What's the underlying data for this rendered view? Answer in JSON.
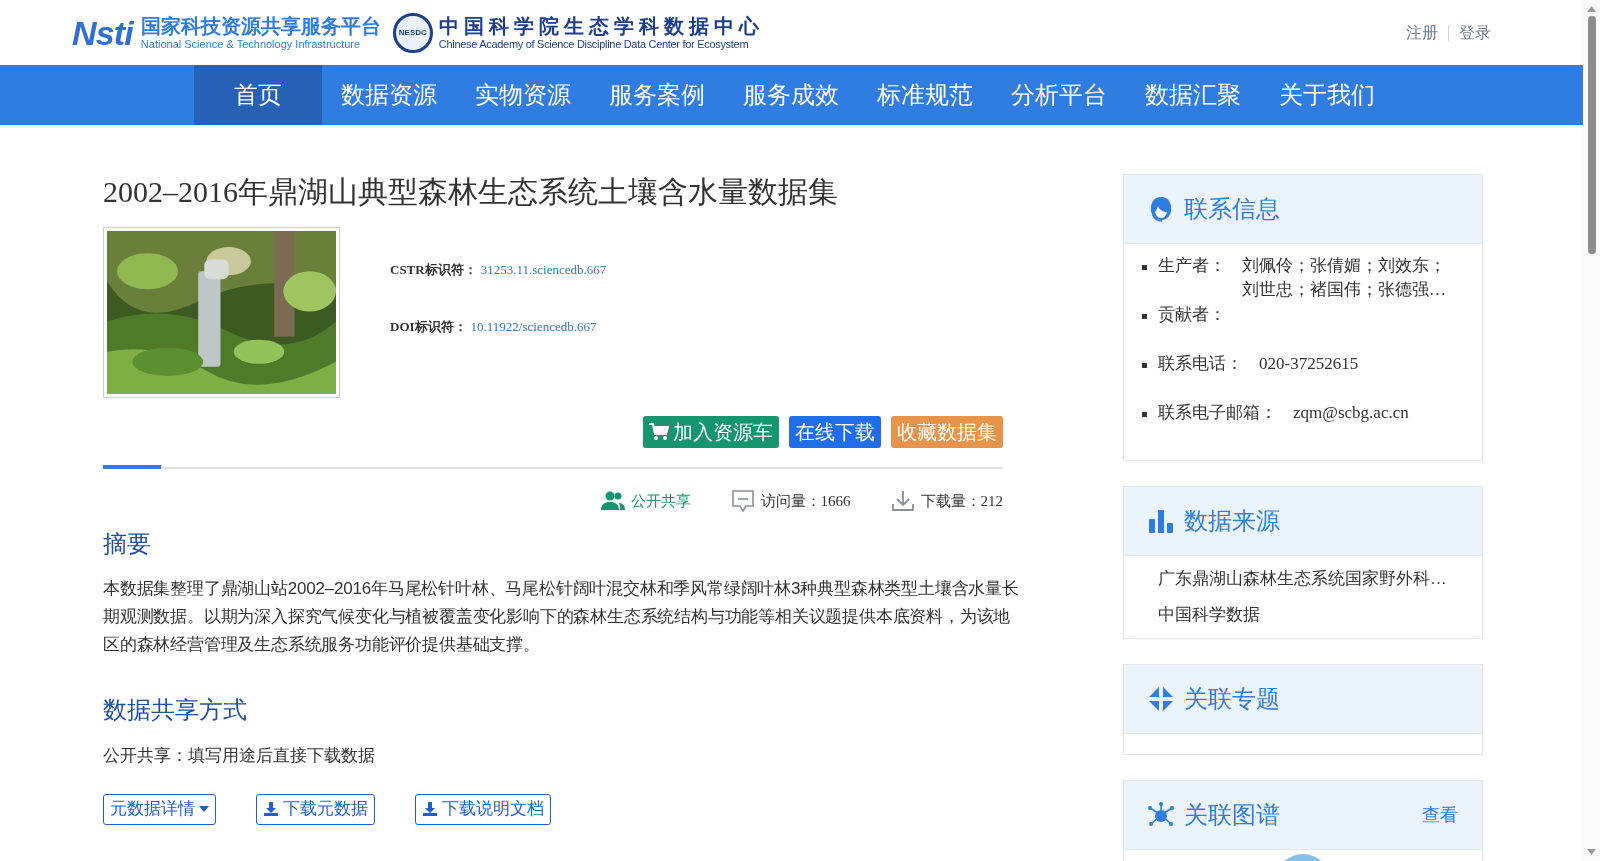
{
  "header": {
    "logo_mark": "Nsti",
    "logo_title": "国家科技资源共享服务平台",
    "logo_subtitle": "National Science & Technology Infrastructure",
    "center_badge": "NESDC",
    "center_title": "中国科学院生态学科数据中心",
    "center_subtitle": "Chinese Academy of Science Discipline Data Center for Ecosystem",
    "links": [
      "注册",
      "登录"
    ]
  },
  "nav": [
    {
      "label": "首页",
      "selected": true
    },
    {
      "label": "数据资源",
      "selected": false
    },
    {
      "label": "实物资源",
      "selected": false
    },
    {
      "label": "服务案例",
      "selected": false
    },
    {
      "label": "服务成效",
      "selected": false
    },
    {
      "label": "标准规范",
      "selected": false
    },
    {
      "label": "分析平台",
      "selected": false
    },
    {
      "label": "数据汇聚",
      "selected": false
    },
    {
      "label": "关于我们",
      "selected": false
    }
  ],
  "dataset": {
    "title": "2002–2016年鼎湖山典型森林生态系统土壤含水量数据集",
    "identifiers": [
      {
        "label": "CSTR标识符：",
        "value": "31253.11.sciencedb.667"
      },
      {
        "label": "DOI标识符：",
        "value": "10.11922/sciencedb.667"
      }
    ],
    "actions": [
      {
        "label": "加入资源车",
        "kind": "cart",
        "color": "#16966f"
      },
      {
        "label": "在线下载",
        "kind": "plain",
        "color": "#1f6ee8"
      },
      {
        "label": "收藏数据集",
        "kind": "plain",
        "color": "#e8934a"
      }
    ],
    "stats": [
      {
        "kind": "share",
        "text": "公开共享"
      },
      {
        "kind": "visits",
        "text": "访问量：1666"
      },
      {
        "kind": "downloads",
        "text": "下载量：212"
      }
    ],
    "abstract_heading": "摘要",
    "abstract": "本数据集整理了鼎湖山站2002–2016年马尾松针叶林、马尾松针阔叶混交林和季风常绿阔叶林3种典型森林类型土壤含水量长期观测数据。以期为深入探究气候变化与植被覆盖变化影响下的森林生态系统结构与功能等相关议题提供本底资料，为该地区的森林经营管理及生态系统服务功能评价提供基础支撑。",
    "sharing_heading": "数据共享方式",
    "sharing_text": "公开共享：填写用途后直接下载数据",
    "bottom_buttons": [
      {
        "label": "元数据详情",
        "kind": "dropdown"
      },
      {
        "label": "下载元数据",
        "kind": "download"
      },
      {
        "label": "下载说明文档",
        "kind": "download"
      }
    ]
  },
  "sidebar": [
    {
      "kind": "contact",
      "title": "联系信息",
      "rows": [
        {
          "label": "生产者：",
          "value_lines": [
            "刘佩伶；张倩媚；刘效东；",
            "刘世忠；褚国伟；张德强…"
          ]
        },
        {
          "label": "贡献者：",
          "value_lines": []
        },
        {
          "label": "联系电话：",
          "value_lines": [
            "020-37252615"
          ]
        },
        {
          "label": "联系电子邮箱：",
          "value_lines": [
            "zqm@scbg.ac.cn"
          ]
        }
      ]
    },
    {
      "kind": "sources",
      "title": "数据来源",
      "items": [
        "广东鼎湖山森林生态系统国家野外科…",
        "中国科学数据"
      ]
    },
    {
      "kind": "topics",
      "title": "关联专题"
    },
    {
      "kind": "graph",
      "title": "关联图谱",
      "link": "查看"
    }
  ]
}
